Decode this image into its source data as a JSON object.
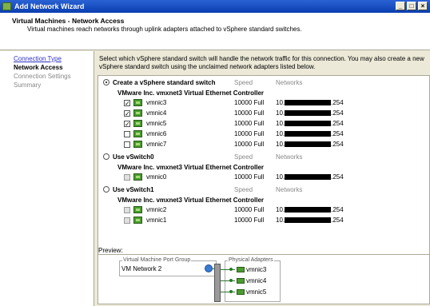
{
  "window": {
    "title": "Add Network Wizard",
    "buttons": [
      "_",
      "□",
      "×"
    ]
  },
  "header": {
    "title": "Virtual Machines - Network Access",
    "subtitle": "Virtual machines reach networks through uplink adapters attached to vSphere standard switches."
  },
  "nav": {
    "items": [
      {
        "label": "Connection Type",
        "state": "link"
      },
      {
        "label": "Network Access",
        "state": "current"
      },
      {
        "label": "Connection Settings",
        "state": "disabled"
      },
      {
        "label": "Summary",
        "state": "disabled"
      }
    ]
  },
  "instructions": "Select which vSphere standard switch will handle the network traffic for this connection. You may also create a new vSphere standard switch using the unclaimed network adapters listed below.",
  "columns": {
    "speed": "Speed",
    "networks": "Networks"
  },
  "options": [
    {
      "label": "Create a vSphere standard switch",
      "selected": true,
      "controller": "VMware Inc. vmxnet3 Virtual Ethernet Controller",
      "nics": [
        {
          "name": "vmnic3",
          "checked": true,
          "enabled": true,
          "speed": "10000 Full",
          "net_prefix": "10.",
          "net_suffix": ".254"
        },
        {
          "name": "vmnic4",
          "checked": true,
          "enabled": true,
          "speed": "10000 Full",
          "net_prefix": "10.",
          "net_suffix": ".254"
        },
        {
          "name": "vmnic5",
          "checked": true,
          "enabled": true,
          "speed": "10000 Full",
          "net_prefix": "10.",
          "net_suffix": ".254"
        },
        {
          "name": "vmnic6",
          "checked": false,
          "enabled": true,
          "speed": "10000 Full",
          "net_prefix": "10.",
          "net_suffix": ".254"
        },
        {
          "name": "vmnic7",
          "checked": false,
          "enabled": true,
          "speed": "10000 Full",
          "net_prefix": "10.",
          "net_suffix": ".254"
        }
      ]
    },
    {
      "label": "Use vSwitch0",
      "selected": false,
      "controller": "VMware Inc. vmxnet3 Virtual Ethernet Controller",
      "nics": [
        {
          "name": "vmnic0",
          "checked": false,
          "enabled": false,
          "speed": "10000 Full",
          "net_prefix": "10.",
          "net_suffix": ".254"
        }
      ]
    },
    {
      "label": "Use vSwitch1",
      "selected": false,
      "controller": "VMware Inc. vmxnet3 Virtual Ethernet Controller",
      "nics": [
        {
          "name": "vmnic2",
          "checked": false,
          "enabled": false,
          "speed": "10000 Full",
          "net_prefix": "10.",
          "net_suffix": ".254"
        },
        {
          "name": "vmnic1",
          "checked": false,
          "enabled": false,
          "speed": "10000 Full",
          "net_prefix": "10.",
          "net_suffix": ".254"
        }
      ]
    }
  ],
  "preview": {
    "label": "Preview:",
    "port_group_legend": "Virtual Machine Port Group",
    "port_group_name": "VM Network 2",
    "adapters_legend": "Physical Adapters",
    "adapters": [
      "vmnic3",
      "vmnic4",
      "vmnic5"
    ]
  }
}
